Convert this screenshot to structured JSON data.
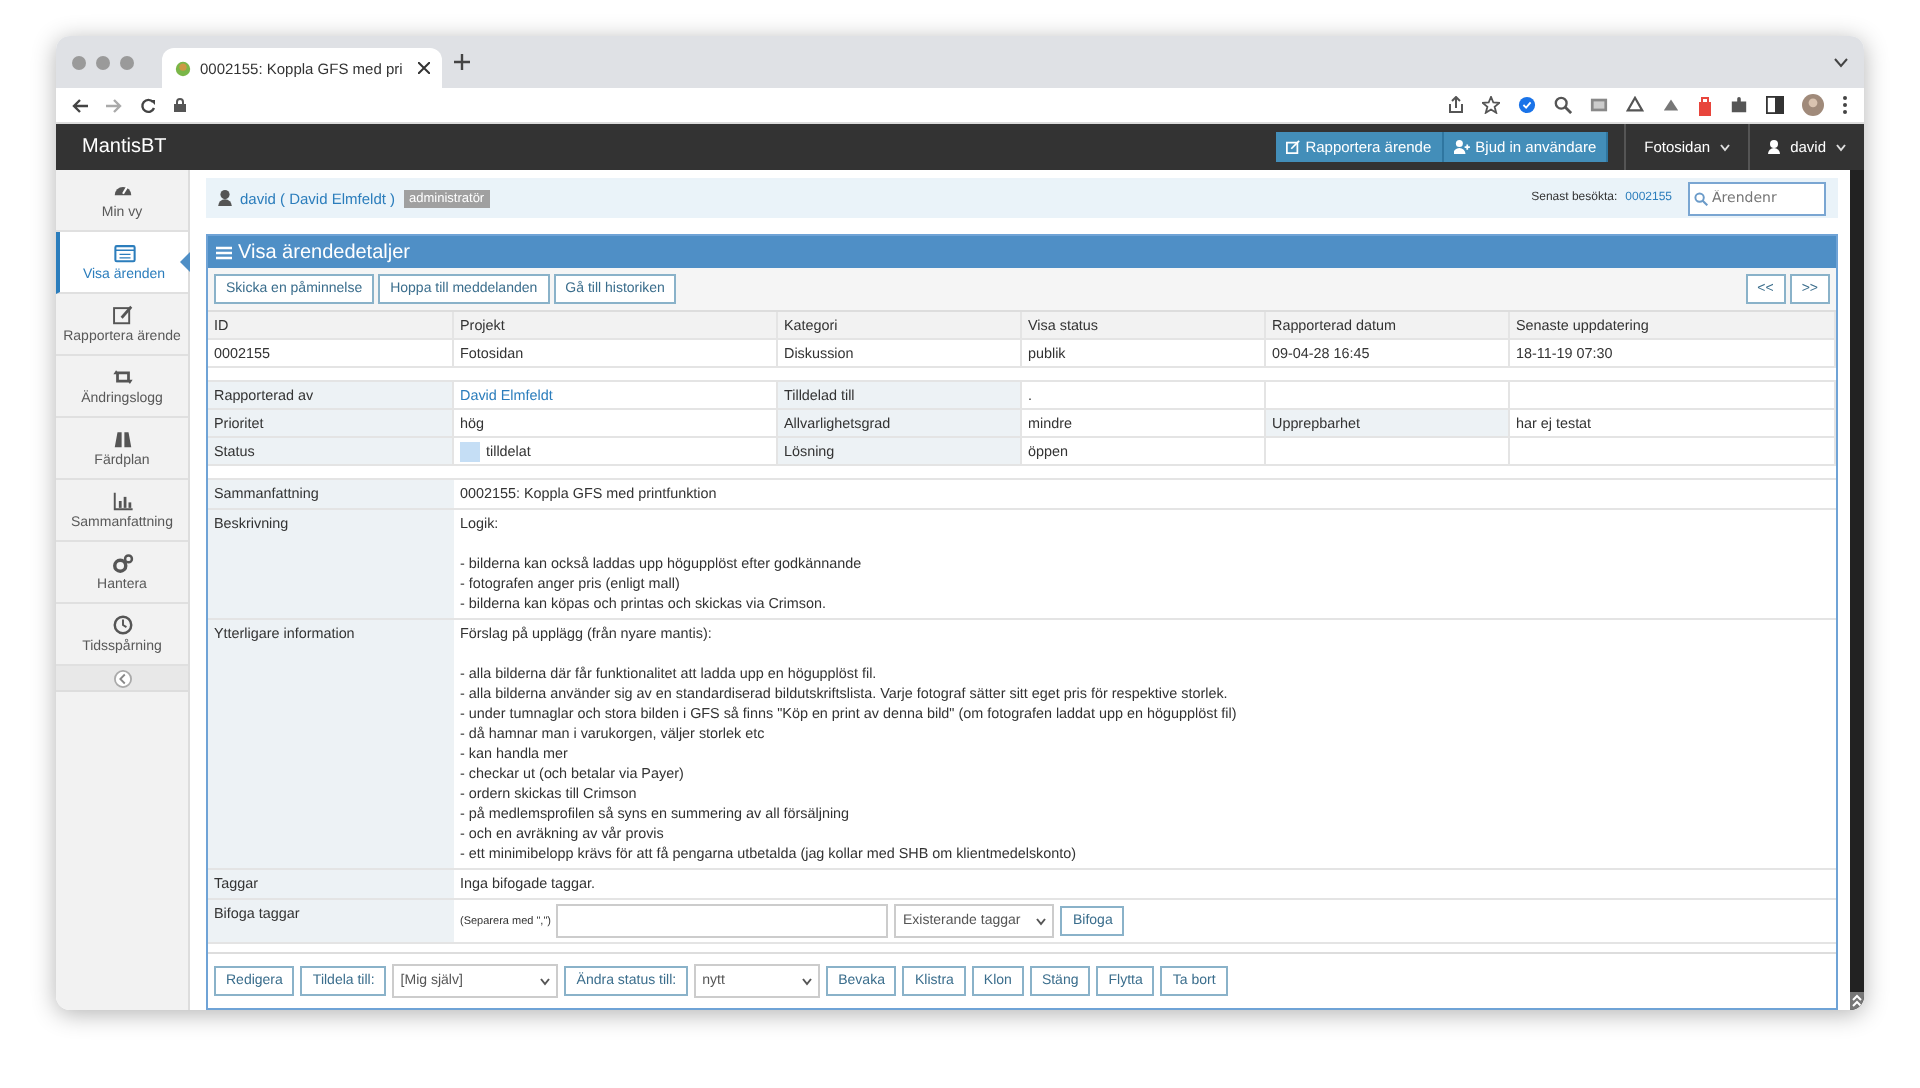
{
  "browser": {
    "tab_title": "0002155: Koppla GFS med pri"
  },
  "navbar": {
    "brand": "MantisBT",
    "buttons": [
      "Rapportera ärende",
      "Bjud in användare"
    ],
    "project": "Fotosidan",
    "user": "david"
  },
  "sidebar": {
    "items": [
      {
        "label": "Min vy",
        "selected": false
      },
      {
        "label": "Visa ärenden",
        "selected": true
      },
      {
        "label": "Rapportera ärende",
        "selected": false
      },
      {
        "label": "Ändringslogg",
        "selected": false
      },
      {
        "label": "Färdplan",
        "selected": false
      },
      {
        "label": "Sammanfattning",
        "selected": false
      },
      {
        "label": "Hantera",
        "selected": false
      },
      {
        "label": "Tidsspårning",
        "selected": false
      }
    ]
  },
  "user_bar": {
    "user": "david ( David Elmfeldt )",
    "role": "administratör",
    "recent_label": "Senast besökta:",
    "recent": "0002155",
    "search": {
      "placeholder": "Ärendenr"
    }
  },
  "panel": {
    "title": "Visa ärendedetaljer",
    "actions": [
      "Skicka en påminnelse",
      "Hoppa till meddelanden",
      "Gå till historiken"
    ],
    "nav": [
      "<<",
      ">>"
    ],
    "columns": [
      "ID",
      "Projekt",
      "Kategori",
      "Visa status",
      "Rapporterad datum",
      "Senaste uppdatering"
    ],
    "values": [
      "0002155",
      "Fotosidan",
      "Diskussion",
      "publik",
      "09-04-28 16:45",
      "18-11-19 07:30"
    ],
    "details": [
      {
        "cells": [
          {
            "kind": "label",
            "text": "Rapporterad av"
          },
          {
            "kind": "link",
            "text": "David Elmfeldt"
          },
          {
            "kind": "label",
            "text": "Tilldelad till"
          },
          {
            "kind": "value",
            "text": "."
          },
          {
            "kind": "empty"
          },
          {
            "kind": "empty"
          }
        ]
      },
      {
        "cells": [
          {
            "kind": "label",
            "text": "Prioritet"
          },
          {
            "kind": "value",
            "text": "hög"
          },
          {
            "kind": "label",
            "text": "Allvarlighetsgrad"
          },
          {
            "kind": "value",
            "text": "mindre"
          },
          {
            "kind": "label",
            "text": "Upprepbarhet"
          },
          {
            "kind": "value",
            "text": "har ej testat"
          }
        ]
      },
      {
        "cells": [
          {
            "kind": "label",
            "text": "Status"
          },
          {
            "kind": "status",
            "text": "tilldelat",
            "color": "#c5def5"
          },
          {
            "kind": "label",
            "text": "Lösning"
          },
          {
            "kind": "value",
            "text": "öppen"
          },
          {
            "kind": "empty"
          },
          {
            "kind": "empty"
          }
        ]
      }
    ],
    "text_rows": [
      {
        "label": "Sammanfattning",
        "paragraphs": [
          [
            "0002155: Koppla GFS med printfunktion"
          ]
        ]
      },
      {
        "label": "Beskrivning",
        "paragraphs": [
          [
            "Logik:"
          ],
          [
            "- bilderna kan också laddas upp högupplöst efter godkännande",
            "- fotografen anger pris (enligt mall)",
            "- bilderna kan köpas och printas och skickas via Crimson."
          ]
        ]
      },
      {
        "label": "Ytterligare information",
        "paragraphs": [
          [
            "Förslag på upplägg (från nyare mantis):"
          ],
          [
            "- alla bilderna där får funktionalitet att ladda upp en högupplöst fil.",
            "- alla bilderna använder sig av en standardiserad bildutskriftslista. Varje fotograf sätter sitt eget pris för respektive storlek.",
            "- under tumnaglar och stora bilden i GFS så finns \"Köp en print av denna bild\" (om fotografen laddat upp en högupplöst fil)",
            "- då hamnar man i varukorgen, väljer storlek etc",
            "- kan handla mer",
            "- checkar ut (och betalar via Payer)",
            "- ordern skickas till Crimson",
            "- på medlemsprofilen så syns en summering av all försäljning",
            "- och en avräkning av vår provis",
            "- ett minimibelopp krävs för att få pengarna utbetalda (jag kollar med SHB om klientmedelskonto)"
          ]
        ]
      },
      {
        "label": "Taggar",
        "paragraphs": [
          [
            "Inga bifogade taggar."
          ]
        ]
      }
    ],
    "attach_tags": {
      "label": "Bifoga taggar",
      "hint": "(Separera med \",\")",
      "select": "Existerande taggar",
      "button": "Bifoga"
    },
    "bottom_actions": [
      {
        "kind": "button",
        "label": "Redigera"
      },
      {
        "kind": "button",
        "label": "Tildela till:"
      },
      {
        "kind": "select",
        "label": "[Mig själv]"
      },
      {
        "kind": "button",
        "label": "Ändra status till:"
      },
      {
        "kind": "select",
        "label": "nytt"
      },
      {
        "kind": "button",
        "label": "Bevaka"
      },
      {
        "kind": "button",
        "label": "Klistra"
      },
      {
        "kind": "button",
        "label": "Klon"
      },
      {
        "kind": "button",
        "label": "Stäng"
      },
      {
        "kind": "button",
        "label": "Flytta"
      },
      {
        "kind": "button",
        "label": "Ta bort"
      }
    ]
  }
}
